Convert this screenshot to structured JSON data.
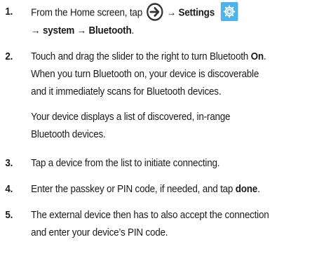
{
  "steps": [
    {
      "number": "1.",
      "prefix": "From the Home screen, tap",
      "arrow1": "→",
      "settings_label": "Settings",
      "line2_arrow": "→",
      "system_label": "system",
      "arrow2": "→",
      "bluetooth_label": "Bluetooth",
      "suffix": ".",
      "icons": [
        "apps-arrow-icon",
        "settings-gear-icon"
      ]
    },
    {
      "number": "2.",
      "line1_prefix": "Touch and drag the slider to the right to turn Bluetooth",
      "on_label": "On",
      "line1_suffix": ".",
      "line2": "When you turn Bluetooth on, your device is discoverable",
      "line3": "and it immediately scans for Bluetooth devices.",
      "para2_line1": "Your device displays a list of discovered, in-range",
      "para2_line2": "Bluetooth devices."
    },
    {
      "number": "3.",
      "text": "Tap a device from the list to initiate connecting."
    },
    {
      "number": "4.",
      "prefix": "Enter the passkey or PIN code, if needed, and tap",
      "done_label": "done",
      "suffix": "."
    },
    {
      "number": "5.",
      "line1": "The external device then has to also accept the connection",
      "line2": "and enter your device’s PIN code."
    }
  ],
  "colors": {
    "text": "#1a1a1a",
    "settings_icon_bg": "#4fb3e8",
    "circle_icon": "#333333"
  }
}
